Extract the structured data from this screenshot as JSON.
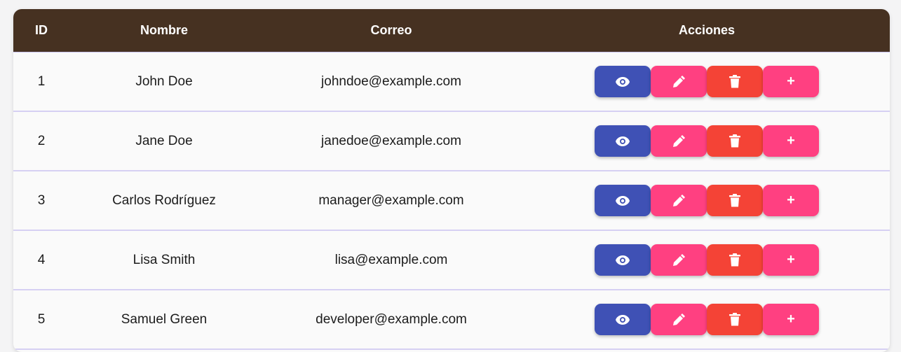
{
  "table": {
    "headers": {
      "id": "ID",
      "name": "Nombre",
      "email": "Correo",
      "actions": "Acciones"
    },
    "rows": [
      {
        "id": "1",
        "name": "John Doe",
        "email": "johndoe@example.com"
      },
      {
        "id": "2",
        "name": "Jane Doe",
        "email": "janedoe@example.com"
      },
      {
        "id": "3",
        "name": "Carlos Rodríguez",
        "email": "manager@example.com"
      },
      {
        "id": "4",
        "name": "Lisa Smith",
        "email": "lisa@example.com"
      },
      {
        "id": "5",
        "name": "Samuel Green",
        "email": "developer@example.com"
      }
    ]
  },
  "actions": {
    "view_icon": "eye-icon",
    "edit_icon": "pencil-icon",
    "delete_icon": "trash-icon",
    "add_icon": "plus-icon",
    "add_label": "+"
  },
  "colors": {
    "header_bg": "#463121",
    "view": "#3f51b5",
    "edit": "#ff4081",
    "delete": "#f44336",
    "add": "#ff4081",
    "row_divider": "#d6d0f3"
  }
}
